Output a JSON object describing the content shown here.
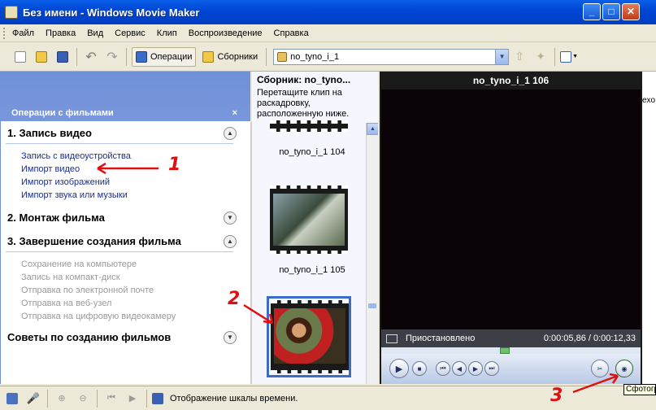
{
  "window": {
    "title": "Без имени - Windows Movie Maker",
    "minimize": "_",
    "maximize": "□",
    "close": "✕"
  },
  "menu": [
    "Файл",
    "Правка",
    "Вид",
    "Сервис",
    "Клип",
    "Воспроизведение",
    "Справка"
  ],
  "toolbar": {
    "operations_label": "Операции",
    "collections_label": "Сборники",
    "collection_select": "no_tyno_i_1"
  },
  "tasks": {
    "pane_title": "Операции с фильмами",
    "close": "×",
    "sections": [
      {
        "title": "1. Запись видео",
        "links": [
          "Запись с видеоустройства",
          "Импорт видео",
          "Импорт изображений",
          "Импорт звука или музыки"
        ]
      },
      {
        "title": "2. Монтаж фильма",
        "links": []
      },
      {
        "title": "3. Завершение создания фильма",
        "links": [
          "Сохранение на компьютере",
          "Запись на компакт-диск",
          "Отправка по электронной почте",
          "Отправка на веб-узел",
          "Отправка на цифровую видеокамеру"
        ]
      },
      {
        "title": "Советы по созданию фильмов",
        "links": []
      }
    ]
  },
  "collection": {
    "title": "Сборник: no_tyno...",
    "hint": "Перетащите клип на раскадровку, расположенную ниже.",
    "clips": [
      "no_tyno_i_1 104",
      "no_tyno_i_1 105"
    ]
  },
  "preview": {
    "title": "no_tyno_i_1 106",
    "state": "Приостановлено",
    "time": "0:00:05,86 / 0:00:12,33"
  },
  "right_edge_text": "exo",
  "bottom": {
    "timeline_label": "Отображение шкалы времени."
  },
  "tooltip": "Сфотогр",
  "annotations": [
    "1",
    "2",
    "3"
  ]
}
